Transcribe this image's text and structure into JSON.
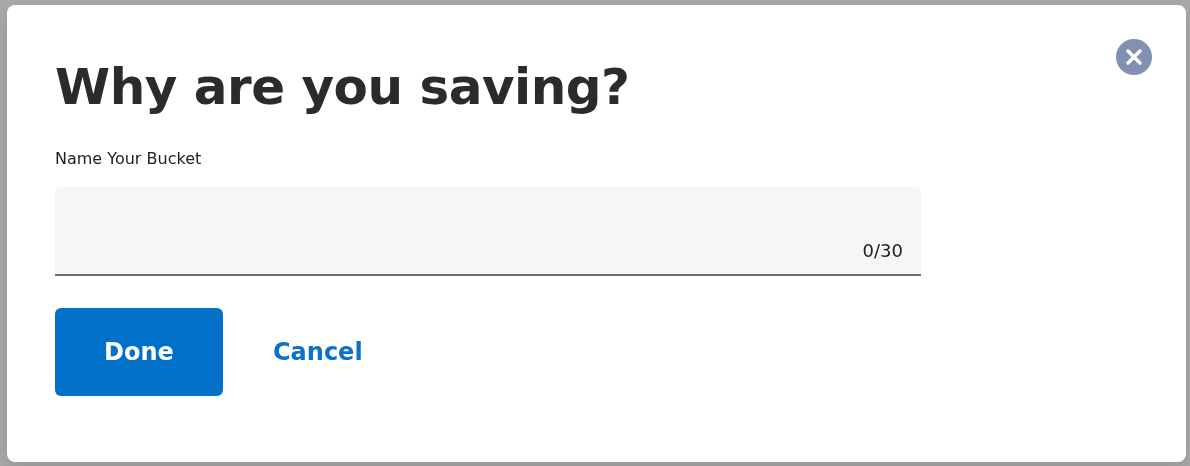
{
  "dialog": {
    "title": "Why are you saving?",
    "field": {
      "label": "Name Your Bucket",
      "counter": "0/30"
    },
    "buttons": [
      {
        "kind": "primary",
        "label": "Done"
      },
      {
        "kind": "link",
        "label": "Cancel"
      }
    ]
  }
}
